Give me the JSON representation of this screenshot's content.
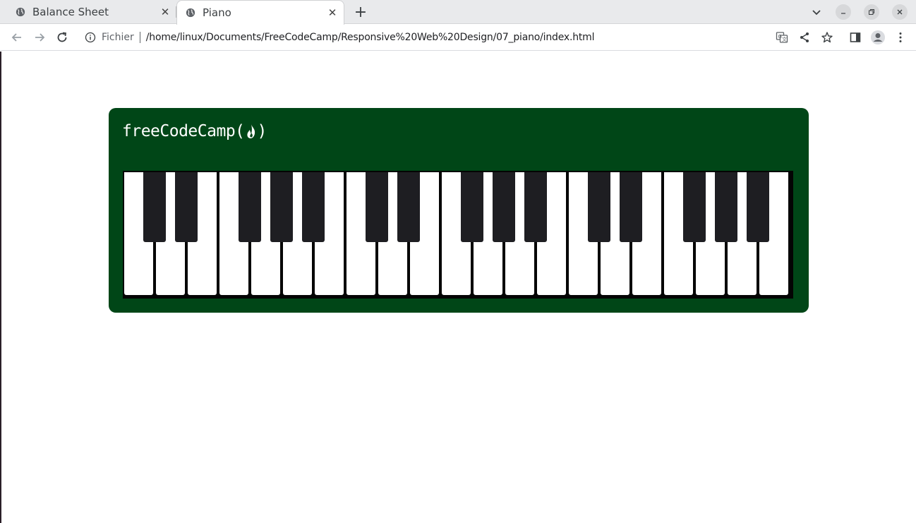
{
  "browser": {
    "tabs": [
      {
        "title": "Balance Sheet",
        "active": false,
        "icon": "globe-icon"
      },
      {
        "title": "Piano",
        "active": true,
        "icon": "globe-icon"
      }
    ],
    "toolbar": {
      "scheme_label": "Fichier",
      "url": "/home/linux/Documents/FreeCodeCamp/Responsive%20Web%20Design/07_piano/index.html"
    }
  },
  "piano": {
    "logo_prefix": "freeCodeCamp(",
    "logo_suffix": ")",
    "logo_icon": "fire-icon",
    "colors": {
      "background": "#004617",
      "frame": "#040404",
      "white_key": "#ffffff",
      "black_key": "#1e1e22"
    },
    "white_key_count": 21,
    "octave_pattern": [
      "white",
      "black",
      "black",
      "white",
      "black",
      "black",
      "black"
    ],
    "octaves": 3
  }
}
